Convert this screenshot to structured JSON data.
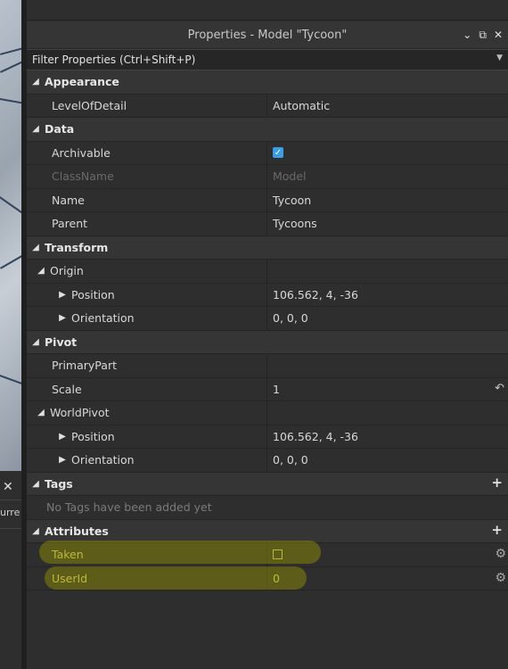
{
  "panel": {
    "title": "Properties - Model \"Tycoon\"",
    "filter_placeholder": "Filter Properties (Ctrl+Shift+P)"
  },
  "left_panel": {
    "cut_text": "urre"
  },
  "categories": {
    "appearance": "Appearance",
    "data": "Data",
    "transform": "Transform",
    "pivot": "Pivot",
    "tags": "Tags",
    "attributes": "Attributes"
  },
  "props": {
    "level_of_detail": {
      "name": "LevelOfDetail",
      "value": "Automatic"
    },
    "archivable": {
      "name": "Archivable",
      "checked": true
    },
    "classname": {
      "name": "ClassName",
      "value": "Model"
    },
    "name": {
      "name": "Name",
      "value": "Tycoon"
    },
    "parent": {
      "name": "Parent",
      "value": "Tycoons"
    },
    "origin": {
      "name": "Origin"
    },
    "origin_position": {
      "name": "Position",
      "value": "106.562, 4, -36"
    },
    "origin_orientation": {
      "name": "Orientation",
      "value": "0, 0, 0"
    },
    "primary_part": {
      "name": "PrimaryPart",
      "value": ""
    },
    "scale": {
      "name": "Scale",
      "value": "1"
    },
    "world_pivot": {
      "name": "WorldPivot"
    },
    "pivot_position": {
      "name": "Position",
      "value": "106.562, 4, -36"
    },
    "pivot_orientation": {
      "name": "Orientation",
      "value": "0, 0, 0"
    }
  },
  "tags": {
    "empty_text": "No Tags have been added yet"
  },
  "attributes": {
    "taken": {
      "name": "Taken",
      "checked": false
    },
    "userid": {
      "name": "UserId",
      "value": "0"
    }
  },
  "colors": {
    "accent": "#3a9ee4",
    "highlight": "#d9d66c"
  }
}
